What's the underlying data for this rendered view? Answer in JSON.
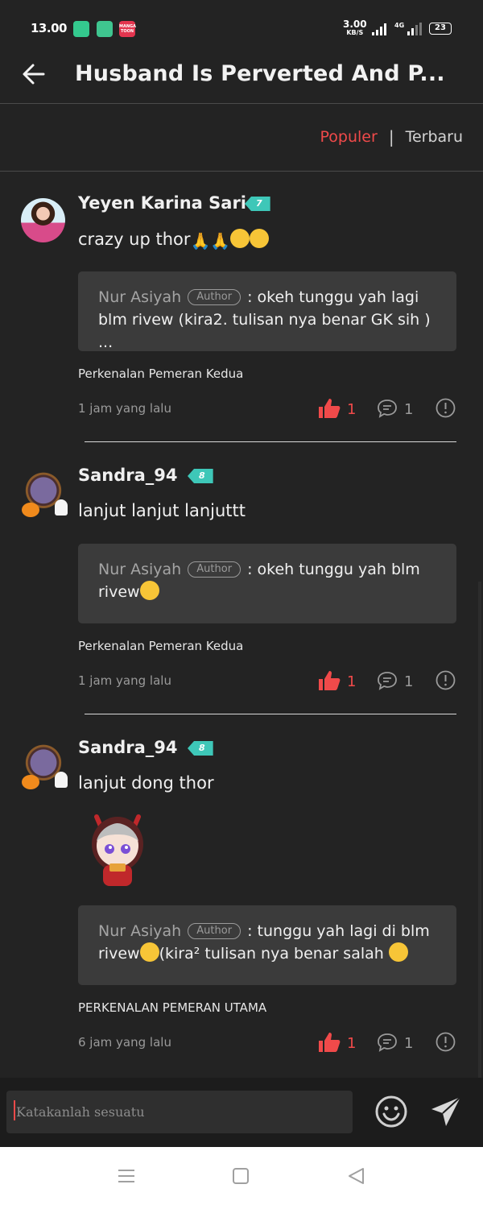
{
  "status_bar": {
    "time": "13.00",
    "speed_value": "3.00",
    "speed_unit": "KB/S",
    "network": "4G",
    "battery": "23",
    "manga_app_label": "MANGA TOON"
  },
  "header": {
    "title": "Husband Is Perverted And P..."
  },
  "sort": {
    "active": "Populer",
    "separator": "|",
    "inactive": "Terbaru"
  },
  "comments": [
    {
      "username": "Yeyen Karina Sari",
      "level": "7",
      "text": "crazy up thor",
      "reply": {
        "name": "Nur Asiyah",
        "badge": "Author",
        "text": ": okeh tunggu yah lagi blm rivew (kira2. tulisan nya benar GK sih ) ..."
      },
      "chapter": "Perkenalan Pemeran Kedua",
      "time": "1 jam yang lalu",
      "likes": "1",
      "replies": "1"
    },
    {
      "username": "Sandra_94",
      "level": "8",
      "text": "lanjut lanjut lanjuttt",
      "reply": {
        "name": "Nur Asiyah",
        "badge": "Author",
        "text": ": okeh tunggu yah blm rivew"
      },
      "chapter": "Perkenalan Pemeran Kedua",
      "time": "1 jam yang lalu",
      "likes": "1",
      "replies": "1"
    },
    {
      "username": "Sandra_94",
      "level": "8",
      "text": "lanjut dong thor",
      "reply": {
        "name": "Nur Asiyah",
        "badge": "Author",
        "text": ": tunggu yah lagi di blm rivew",
        "text_end": "(kira² tulisan nya benar salah "
      },
      "chapter": "PERKENALAN PEMERAN UTAMA",
      "time": "6 jam yang lalu",
      "likes": "1",
      "replies": "1"
    }
  ],
  "composer": {
    "placeholder": "Katakanlah sesuatu"
  },
  "colors": {
    "background": "#232323",
    "accent": "#f04a4a",
    "level_badge": "#3ec7b8",
    "reply_box": "#3b3b3b"
  },
  "icons": [
    "back-arrow-icon",
    "thumbs-up-icon",
    "comment-bubble-icon",
    "report-icon",
    "emoji-icon",
    "send-icon",
    "menu-icon",
    "home-icon",
    "nav-back-icon"
  ]
}
